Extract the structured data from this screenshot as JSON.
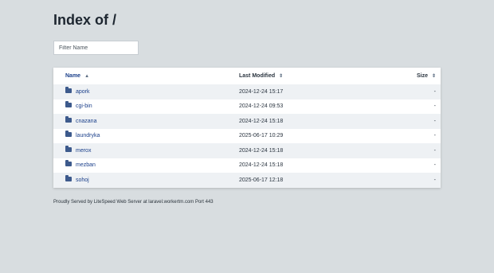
{
  "page": {
    "title": "Index of /"
  },
  "filter": {
    "placeholder": "Filter Name",
    "value": ""
  },
  "table": {
    "headers": {
      "name": "Name",
      "modified": "Last Modified",
      "size": "Size",
      "sort_icon": "sort-icon"
    },
    "rows": [
      {
        "icon": "folder-icon",
        "name": "apork",
        "modified": "2024-12-24 15:17",
        "size": "-"
      },
      {
        "icon": "folder-icon",
        "name": "cgi-bin",
        "modified": "2024-12-24 09:53",
        "size": "-"
      },
      {
        "icon": "folder-icon",
        "name": "cnazana",
        "modified": "2024-12-24 15:18",
        "size": "-"
      },
      {
        "icon": "folder-icon",
        "name": "laundryka",
        "modified": "2025-06-17 10:29",
        "size": "-"
      },
      {
        "icon": "folder-icon",
        "name": "merox",
        "modified": "2024-12-24 15:18",
        "size": "-"
      },
      {
        "icon": "folder-icon",
        "name": "mezban",
        "modified": "2024-12-24 15:18",
        "size": "-"
      },
      {
        "icon": "folder-icon",
        "name": "sohoj",
        "modified": "2025-06-17 12:18",
        "size": "-"
      }
    ]
  },
  "footer": {
    "text": "Proudly Served by LiteSpeed Web Server at laravel.workertm.com Port 443"
  },
  "colors": {
    "background": "#d8dde0",
    "link": "#1a3f8a",
    "row_alt": "#eef1f4",
    "folder": "#3d5a8c"
  }
}
